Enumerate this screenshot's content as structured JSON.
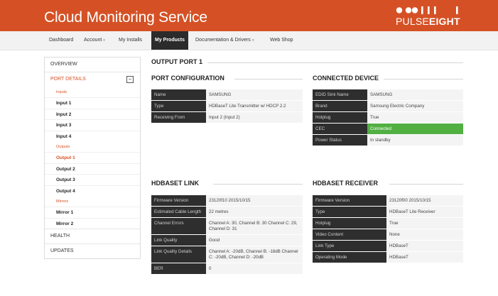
{
  "header": {
    "title": "Cloud Monitoring Service",
    "logo_word_regular": "PULSE",
    "logo_word_bold": "EIGHT"
  },
  "colors": {
    "brand": "#d55125",
    "nav_active": "#2b2b2b",
    "key_cell": "#2e2e2e",
    "value_cell": "#f4f4f4",
    "status_ok": "#52b043"
  },
  "nav": {
    "dashboard": "Dashboard",
    "account": "Account",
    "my_installs": "My Installs",
    "my_products": "My Products",
    "documentation": "Documentation & Drivers",
    "web_shop": "Web Shop",
    "dropdown_icon": "chevron-down-icon"
  },
  "sidebar": {
    "overview": "OVERVIEW",
    "port_details": "PORT DETAILS",
    "collapse_symbol": "−",
    "inputs_label": "Inputs",
    "inputs": [
      "Input 1",
      "Input 2",
      "Input 3",
      "Input 4"
    ],
    "outputs_label": "Outputs",
    "outputs": [
      "Output 1",
      "Output 2",
      "Output 3",
      "Output 4"
    ],
    "mirrors_label": "Mirrors",
    "mirrors": [
      "Mirror 1",
      "Mirror 2"
    ],
    "health": "HEALTH",
    "updates": "UPDATES"
  },
  "main": {
    "title": "OUTPUT PORT 1",
    "port_configuration": {
      "title": "PORT CONFIGURATION",
      "rows": [
        {
          "key": "Name",
          "value": "SAMSUNG"
        },
        {
          "key": "Type",
          "value": "HDBaseT Lite Transmitter w/ HDCP 2.2"
        },
        {
          "key": "Receiving From",
          "value": "Input 2 (Input 2)"
        }
      ]
    },
    "connected_device": {
      "title": "CONNECTED DEVICE",
      "rows": [
        {
          "key": "EDID Sink Name",
          "value": "SAMSUNG"
        },
        {
          "key": "Brand",
          "value": "Samsung Electric Company"
        },
        {
          "key": "Hotplug",
          "value": "True"
        },
        {
          "key": "CEC",
          "value": "Connected"
        },
        {
          "key": "Power Status",
          "value": "In standby"
        }
      ]
    },
    "hdbaset_link": {
      "title": "HDBASET LINK",
      "rows": [
        {
          "key": "Firmware Version",
          "value": "23120f10 2015/10/15"
        },
        {
          "key": "Estimated Cable Length",
          "value": "22 metres"
        },
        {
          "key": "Channel Errors",
          "value": "Channel A: 30, Channel B: 30 Channel C: 29, Channel D: 31"
        },
        {
          "key": "Link Quality",
          "value": "Good"
        },
        {
          "key": "Link Quality Details",
          "value": "Channel A: -20dB, Channel B: -18dB Channel C: -20dB, Channel D: -20dB"
        },
        {
          "key": "BER",
          "value": "0"
        }
      ]
    },
    "hdbaset_receiver": {
      "title": "HDBASET RECEIVER",
      "rows": [
        {
          "key": "Firmware Version",
          "value": "23120f00 2015/10/15"
        },
        {
          "key": "Type",
          "value": "HDBaseT Lite Receiver"
        },
        {
          "key": "Hotplug",
          "value": "True"
        },
        {
          "key": "Video Content",
          "value": "None"
        },
        {
          "key": "Link Type",
          "value": "HDBaseT"
        },
        {
          "key": "Operating Mode",
          "value": "HDBaseT"
        }
      ]
    }
  }
}
